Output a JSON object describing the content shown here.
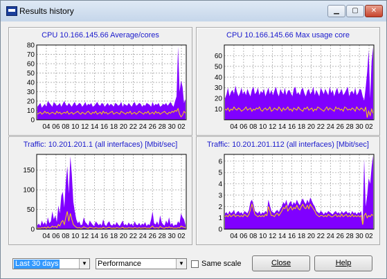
{
  "window": {
    "title": "Results history"
  },
  "titlebar": {
    "min_icon": "minimize-icon",
    "max_icon": "maximize-icon",
    "close_icon": "close-icon"
  },
  "charts": [
    {
      "title": "CPU 10.166.145.66 Average/cores",
      "yticks": [
        "80",
        "70",
        "60",
        "50",
        "40",
        "30",
        "20",
        "10",
        "0"
      ],
      "ymax": 80,
      "xticks": [
        "04",
        "06",
        "08",
        "10",
        "12",
        "14",
        "16",
        "18",
        "20",
        "22",
        "24",
        "26",
        "28",
        "30",
        "02"
      ],
      "colors": {
        "fill": "#8000ff",
        "line": "#ffd700"
      },
      "chart_data": {
        "type": "area",
        "x_count": 100,
        "series": [
          {
            "values": [
              14,
              16,
              18,
              13,
              15,
              17,
              14,
              20,
              18,
              16,
              14,
              19,
              17,
              15,
              16,
              18,
              14,
              17,
              20,
              16,
              15,
              18,
              16,
              14,
              17,
              19,
              15,
              16,
              18,
              17,
              14,
              16,
              19,
              15,
              17,
              16,
              18,
              14,
              15,
              17,
              19,
              16,
              15,
              18,
              17,
              14,
              16,
              18,
              15,
              17,
              16,
              14,
              18,
              17,
              15,
              16,
              19,
              14,
              17,
              16,
              15,
              18,
              16,
              14,
              17,
              19,
              15,
              16,
              18,
              17,
              14,
              16,
              15,
              18,
              17,
              16,
              14,
              19,
              15,
              17,
              16,
              18,
              14,
              15,
              17,
              16,
              18,
              15,
              17,
              19,
              16,
              14,
              20,
              25,
              78,
              30,
              42,
              35,
              18,
              22
            ]
          },
          {
            "values": [
              6,
              7,
              8,
              6,
              7,
              9,
              7,
              8,
              6,
              7,
              8,
              7,
              6,
              9,
              7,
              8,
              6,
              7,
              8,
              7,
              9,
              6,
              7,
              8,
              6,
              7,
              8,
              9,
              7,
              6,
              8,
              7,
              6,
              8,
              9,
              7,
              6,
              8,
              7,
              9,
              6,
              7,
              8,
              6,
              9,
              7,
              8,
              6,
              7,
              8,
              9,
              6,
              7,
              8,
              7,
              6,
              9,
              8,
              7,
              6,
              8,
              7,
              9,
              6,
              7,
              8,
              6,
              7,
              9,
              8,
              7,
              6,
              8,
              7,
              9,
              6,
              7,
              8,
              6,
              9,
              7,
              8,
              6,
              7,
              8,
              9,
              7,
              6,
              8,
              7,
              9,
              8,
              10,
              9,
              12,
              6,
              3,
              5,
              9,
              7
            ]
          }
        ]
      }
    },
    {
      "title": "CPU 10.166.145.66 Max usage core",
      "yticks": [
        "60",
        "50",
        "40",
        "30",
        "20",
        "10"
      ],
      "ymax": 70,
      "xticks": [
        "04",
        "06",
        "08",
        "10",
        "12",
        "14",
        "16",
        "18",
        "20",
        "22",
        "24",
        "26",
        "28",
        "30",
        "02"
      ],
      "colors": {
        "fill": "#8000ff",
        "line": "#ffd700"
      },
      "chart_data": {
        "type": "area",
        "x_count": 100,
        "series": [
          {
            "values": [
              20,
              24,
              30,
              22,
              26,
              28,
              24,
              32,
              26,
              22,
              25,
              30,
              24,
              27,
              23,
              29,
              25,
              22,
              28,
              31,
              24,
              26,
              30,
              23,
              27,
              25,
              29,
              22,
              26,
              30,
              24,
              28,
              23,
              27,
              31,
              25,
              22,
              29,
              26,
              24,
              30,
              23,
              27,
              28,
              25,
              22,
              29,
              31,
              24,
              26,
              23,
              28,
              30,
              25,
              22,
              27,
              29,
              24,
              26,
              31,
              23,
              28,
              25,
              22,
              30,
              27,
              24,
              29,
              26,
              23,
              31,
              25,
              28,
              22,
              27,
              30,
              24,
              26,
              29,
              23,
              25,
              28,
              31,
              22,
              26,
              27,
              24,
              30,
              23,
              25,
              29,
              28,
              22,
              18,
              30,
              45,
              65,
              20,
              55,
              68
            ]
          },
          {
            "values": [
              10,
              9,
              11,
              8,
              10,
              9,
              12,
              10,
              9,
              11,
              10,
              8,
              9,
              10,
              12,
              9,
              10,
              11,
              8,
              10,
              9,
              11,
              10,
              12,
              9,
              8,
              10,
              11,
              9,
              10,
              12,
              8,
              9,
              11,
              10,
              9,
              12,
              10,
              8,
              11,
              9,
              10,
              12,
              9,
              10,
              8,
              11,
              10,
              9,
              12,
              10,
              9,
              8,
              11,
              10,
              12,
              9,
              10,
              11,
              8,
              10,
              9,
              12,
              11,
              10,
              9,
              8,
              10,
              12,
              9,
              11,
              10,
              9,
              8,
              12,
              10,
              11,
              9,
              10,
              8,
              12,
              11,
              9,
              10,
              9,
              11,
              10,
              8,
              12,
              10,
              9,
              11,
              10,
              8,
              12,
              2,
              8,
              4,
              10,
              6
            ]
          }
        ]
      }
    },
    {
      "title": "Traffic: 10.201.201.1 (all interfaces) [Mbit/sec]",
      "yticks": [
        "150",
        "100",
        "50",
        "0"
      ],
      "ymax": 190,
      "xticks": [
        "04",
        "06",
        "08",
        "10",
        "12",
        "14",
        "16",
        "18",
        "20",
        "22",
        "24",
        "26",
        "28",
        "30",
        "02"
      ],
      "colors": {
        "fill": "#8000ff",
        "line": "#ffd700"
      },
      "chart_data": {
        "type": "area",
        "x_count": 100,
        "series": [
          {
            "values": [
              10,
              14,
              8,
              22,
              12,
              18,
              9,
              30,
              15,
              20,
              45,
              25,
              35,
              18,
              60,
              40,
              85,
              95,
              55,
              120,
              160,
              90,
              185,
              140,
              70,
              45,
              25,
              15,
              20,
              10,
              12,
              30,
              18,
              14,
              9,
              22,
              16,
              11,
              8,
              20,
              15,
              10,
              14,
              9,
              25,
              12,
              8,
              16,
              20,
              11,
              9,
              14,
              10,
              18,
              12,
              8,
              15,
              22,
              10,
              13,
              9,
              17,
              11,
              14,
              8,
              20,
              12,
              10,
              16,
              9,
              14,
              11,
              18,
              8,
              13,
              10,
              25,
              45,
              15,
              12,
              20,
              10,
              35,
              18,
              12,
              9,
              22,
              14,
              30,
              11,
              16,
              8,
              12,
              10,
              20,
              15,
              40,
              30,
              25,
              10
            ]
          },
          {
            "values": [
              2,
              3,
              2,
              4,
              3,
              5,
              2,
              6,
              3,
              4,
              8,
              5,
              7,
              4,
              12,
              8,
              18,
              22,
              12,
              30,
              45,
              20,
              40,
              25,
              12,
              8,
              5,
              3,
              4,
              2,
              3,
              6,
              4,
              3,
              2,
              5,
              4,
              3,
              2,
              4,
              3,
              2,
              3,
              2,
              5,
              3,
              2,
              4,
              5,
              3,
              2,
              3,
              2,
              4,
              3,
              2,
              3,
              5,
              2,
              3,
              2,
              4,
              3,
              3,
              2,
              4,
              3,
              2,
              4,
              2,
              3,
              3,
              4,
              2,
              3,
              2,
              5,
              8,
              3,
              3,
              4,
              2,
              7,
              4,
              3,
              2,
              5,
              3,
              6,
              3,
              4,
              2,
              3,
              2,
              4,
              3,
              8,
              6,
              5,
              3
            ]
          }
        ]
      }
    },
    {
      "title": "Traffic: 10.201.201.112  (all interfaces) [Mbit/sec]",
      "yticks": [
        "6",
        "5",
        "4",
        "3",
        "2",
        "1",
        "0"
      ],
      "ymax": 6.6,
      "xticks": [
        "04",
        "06",
        "08",
        "10",
        "12",
        "14",
        "16",
        "18",
        "20",
        "22",
        "24",
        "26",
        "28",
        "30",
        "02"
      ],
      "colors": {
        "fill": "#8000ff",
        "line": "#ffd700"
      },
      "chart_data": {
        "type": "area",
        "x_count": 100,
        "series": [
          {
            "values": [
              1.4,
              1.5,
              1.3,
              1.6,
              1.4,
              1.5,
              1.7,
              1.3,
              1.5,
              1.6,
              1.4,
              1.5,
              1.3,
              1.6,
              1.5,
              1.4,
              1.7,
              2.4,
              2.6,
              2.2,
              1.6,
              1.5,
              1.4,
              1.6,
              1.3,
              1.5,
              1.4,
              1.6,
              1.5,
              2.6,
              2.1,
              1.6,
              1.5,
              1.4,
              1.6,
              1.7,
              1.5,
              1.8,
              2.0,
              2.4,
              2.2,
              2.6,
              2.0,
              2.3,
              2.5,
              2.1,
              2.4,
              2.2,
              2.6,
              2.3,
              2.1,
              2.5,
              2.7,
              2.4,
              2.2,
              2.6,
              2.3,
              2.8,
              2.5,
              2.2,
              2.0,
              1.6,
              1.5,
              1.4,
              1.6,
              1.5,
              1.3,
              1.5,
              1.4,
              1.6,
              1.5,
              1.4,
              1.3,
              1.5,
              1.6,
              1.4,
              1.5,
              1.3,
              1.6,
              1.4,
              1.5,
              1.6,
              1.4,
              1.5,
              1.3,
              1.6,
              1.4,
              1.5,
              1.3,
              1.5,
              1.4,
              1.6,
              0.6,
              6.2,
              2.0,
              3.0,
              4.5,
              4.0,
              5.5,
              6.5
            ]
          },
          {
            "values": [
              1.1,
              1.2,
              1.1,
              1.3,
              1.1,
              1.2,
              1.3,
              1.1,
              1.2,
              1.2,
              1.1,
              1.2,
              1.1,
              1.3,
              1.2,
              1.1,
              1.3,
              1.7,
              2.2,
              1.8,
              1.3,
              1.2,
              1.1,
              1.2,
              1.1,
              1.2,
              1.1,
              1.3,
              1.2,
              2.0,
              1.6,
              1.2,
              1.2,
              1.1,
              1.3,
              1.4,
              1.2,
              1.4,
              1.6,
              1.9,
              1.8,
              2.1,
              1.6,
              1.8,
              2.0,
              1.7,
              1.9,
              1.8,
              2.1,
              1.8,
              1.7,
              2.0,
              2.2,
              1.9,
              1.8,
              2.1,
              1.8,
              2.2,
              2.0,
              1.8,
              1.6,
              1.3,
              1.2,
              1.1,
              1.2,
              1.2,
              1.1,
              1.2,
              1.1,
              1.3,
              1.2,
              1.1,
              1.1,
              1.2,
              1.3,
              1.1,
              1.2,
              1.1,
              1.3,
              1.1,
              1.2,
              1.3,
              1.1,
              1.2,
              1.1,
              1.3,
              1.1,
              1.2,
              1.1,
              1.2,
              1.1,
              1.2,
              0.4,
              1.2,
              1.4,
              1.0,
              1.2,
              1.1,
              1.3,
              1.2
            ]
          }
        ]
      }
    }
  ],
  "controls": {
    "range_value": "Last 30 days",
    "profile_value": "Performance",
    "same_scale_label": "Same scale",
    "close_label": "Close",
    "help_label": "Help"
  }
}
